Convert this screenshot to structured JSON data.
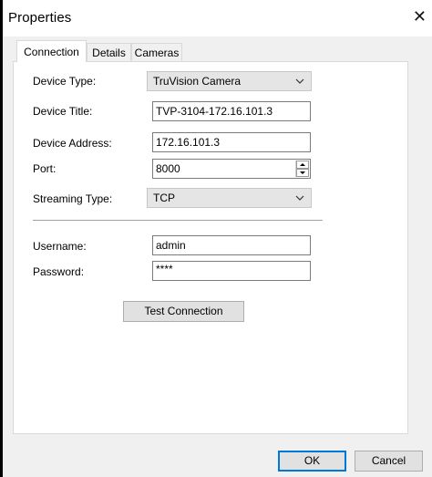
{
  "window": {
    "title": "Properties",
    "close_glyph": "✕"
  },
  "tabs": [
    {
      "label": "Connection",
      "active": true
    },
    {
      "label": "Details",
      "active": false
    },
    {
      "label": "Cameras",
      "active": false
    }
  ],
  "form": {
    "device_type": {
      "label": "Device Type:",
      "value": "TruVision Camera"
    },
    "device_title": {
      "label": "Device Title:",
      "value": "TVP-3104-172.16.101.3"
    },
    "device_address": {
      "label": "Device Address:",
      "value": "172.16.101.3"
    },
    "port": {
      "label": "Port:",
      "value": "8000"
    },
    "streaming_type": {
      "label": "Streaming Type:",
      "value": "TCP"
    },
    "username": {
      "label": "Username:",
      "value": "admin"
    },
    "password": {
      "label": "Password:",
      "value": "****"
    }
  },
  "buttons": {
    "test_connection": "Test Connection",
    "ok": "OK",
    "cancel": "Cancel"
  },
  "colors": {
    "accent": "#0078d7"
  },
  "icons": [
    "close-icon",
    "chevron-down-icon",
    "spin-up-icon",
    "spin-down-icon"
  ]
}
